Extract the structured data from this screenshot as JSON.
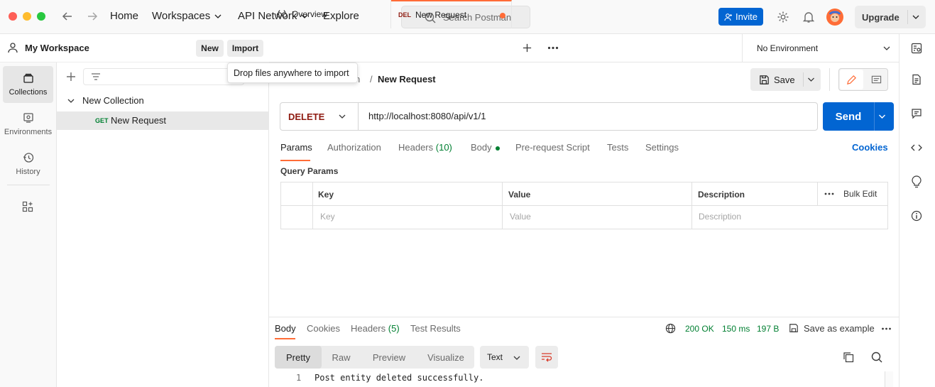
{
  "topbar": {
    "nav": {
      "home": "Home",
      "workspaces": "Workspaces",
      "api_network": "API Network",
      "explore": "Explore"
    },
    "search_placeholder": "Search Postman",
    "invite_label": "Invite",
    "upgrade_label": "Upgrade"
  },
  "workspace": {
    "name": "My Workspace",
    "new_label": "New",
    "import_label": "Import",
    "import_tooltip": "Drop files anywhere to import"
  },
  "left_rail": [
    {
      "label": "Collections",
      "icon": "collections-icon"
    },
    {
      "label": "Environments",
      "icon": "environments-icon"
    },
    {
      "label": "History",
      "icon": "history-icon"
    }
  ],
  "tree": {
    "collection": "New Collection",
    "request_method": "GET",
    "request_name": "New Request"
  },
  "tabs": [
    {
      "label": "Overview"
    },
    {
      "method": "DEL",
      "label": "New Request"
    }
  ],
  "environment": "No Environment",
  "breadcrumb": {
    "parent": "n",
    "current": "New Request"
  },
  "actions": {
    "save": "Save"
  },
  "request": {
    "method": "DELETE",
    "url": "http://localhost:8080/api/v1/1",
    "send": "Send",
    "tabs": {
      "params": "Params",
      "authorization": "Authorization",
      "headers": "Headers",
      "headers_count": "(10)",
      "body": "Body",
      "prerequest": "Pre-request Script",
      "tests": "Tests",
      "settings": "Settings"
    },
    "cookies": "Cookies",
    "query_params_title": "Query Params",
    "table": {
      "key": "Key",
      "value": "Value",
      "description": "Description",
      "bulk_edit": "Bulk Edit",
      "key_ph": "Key",
      "value_ph": "Value",
      "description_ph": "Description"
    }
  },
  "response": {
    "tabs": {
      "body": "Body",
      "cookies": "Cookies",
      "headers": "Headers",
      "headers_count": "(5)",
      "test_results": "Test Results"
    },
    "status": "200 OK",
    "time": "150 ms",
    "size": "197 B",
    "save_example": "Save as example",
    "views": {
      "pretty": "Pretty",
      "raw": "Raw",
      "preview": "Preview",
      "visualize": "Visualize"
    },
    "format": "Text",
    "line_number": "1",
    "line_content": "Post entity deleted successfully."
  },
  "colors": {
    "accent": "#0265d2",
    "delete_method": "#8e1a10",
    "get_method": "#007f31",
    "status_ok": "#007f31",
    "active_tab": "#ff6c37"
  }
}
